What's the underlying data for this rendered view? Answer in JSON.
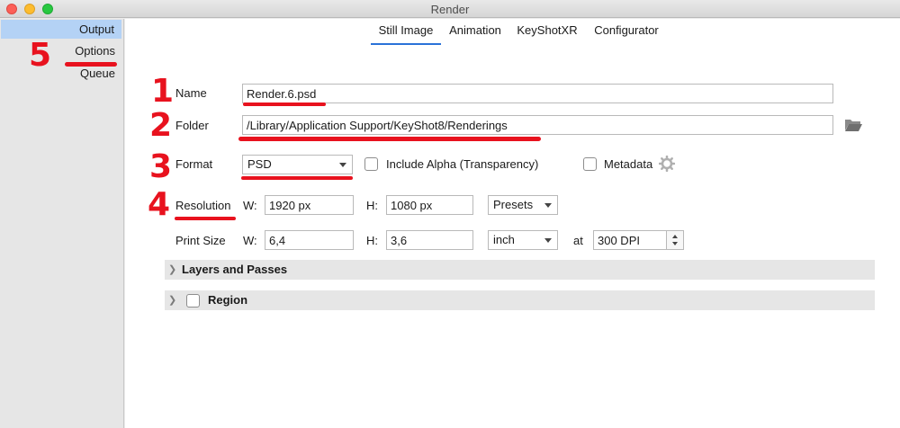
{
  "window": {
    "title": "Render"
  },
  "sidebar": {
    "items": [
      {
        "label": "Output",
        "active": true
      },
      {
        "label": "Options",
        "active": false
      },
      {
        "label": "Queue",
        "active": false
      }
    ]
  },
  "tabs": [
    {
      "label": "Still Image",
      "active": true
    },
    {
      "label": "Animation",
      "active": false
    },
    {
      "label": "KeyShotXR",
      "active": false
    },
    {
      "label": "Configurator",
      "active": false
    }
  ],
  "form": {
    "name": {
      "label": "Name",
      "value": "Render.6.psd"
    },
    "folder": {
      "label": "Folder",
      "value": "/Library/Application Support/KeyShot8/Renderings",
      "icon": "folder-open-icon"
    },
    "format": {
      "label": "Format",
      "value": "PSD",
      "include_alpha_label": "Include Alpha (Transparency)",
      "include_alpha_checked": false,
      "metadata_label": "Metadata",
      "metadata_checked": false,
      "metadata_icon": "gear-icon"
    },
    "resolution": {
      "label": "Resolution",
      "w_label": "W:",
      "w_value": "1920 px",
      "h_label": "H:",
      "h_value": "1080 px",
      "presets_label": "Presets"
    },
    "print_size": {
      "label": "Print Size",
      "w_label": "W:",
      "w_value": "6,4",
      "h_label": "H:",
      "h_value": "3,6",
      "unit": "inch",
      "at_label": "at",
      "dpi_value": "300 DPI"
    }
  },
  "sections": {
    "layers": {
      "title": "Layers and Passes",
      "expanded": false
    },
    "region": {
      "title": "Region",
      "expanded": false,
      "checked": false
    }
  },
  "annotations": {
    "color": "#e8121e",
    "numbers": [
      "1",
      "2",
      "3",
      "4",
      "5"
    ]
  },
  "colors": {
    "accent": "#2a72d8",
    "selection": "#b4d2f5"
  }
}
